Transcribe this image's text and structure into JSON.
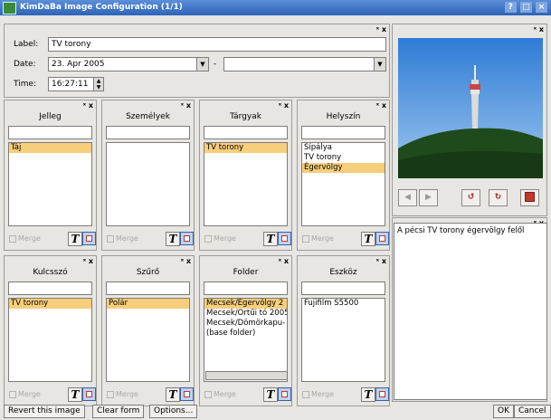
{
  "window": {
    "title": "KimDaBa Image Configuration (1/1)",
    "buttons": [
      "?",
      "□",
      "×"
    ]
  },
  "dock_close": "ˣ x",
  "fields": {
    "label_caption": "Label:",
    "label_value": "TV torony",
    "date_caption": "Date:",
    "date_from": "23. Apr 2005",
    "date_separator": "-",
    "date_to": "",
    "time_caption": "Time:",
    "time_value": "16:27:11"
  },
  "categories": [
    {
      "title": "Jelleg",
      "items": [
        "Táj"
      ],
      "selected": [
        "Táj"
      ]
    },
    {
      "title": "Személyek",
      "items": [],
      "selected": []
    },
    {
      "title": "Tárgyak",
      "items": [
        "TV torony"
      ],
      "selected": [
        "TV torony"
      ]
    },
    {
      "title": "Helyszín",
      "items": [
        "Sípálya",
        "TV torony",
        "Égervölgy"
      ],
      "selected": [
        "Égervölgy"
      ]
    },
    {
      "title": "Kulcsszó",
      "items": [
        "TV torony"
      ],
      "selected": [
        "TV torony"
      ]
    },
    {
      "title": "Szűrő",
      "items": [
        "Polár"
      ],
      "selected": [
        "Polár"
      ]
    },
    {
      "title": "Folder",
      "items": [
        "Mecsek/Égervölgy 2",
        "Mecsek/Ortűi tó 2005",
        "Mecsek/Dömörkapu-",
        "(base folder)"
      ],
      "selected": [
        "Mecsek/Égervölgy 2"
      ]
    },
    {
      "title": "Eszköz",
      "items": [
        "Fujifilm S5500"
      ],
      "selected": []
    }
  ],
  "merge_label": "Merge",
  "text_button": "T",
  "description": "A pécsi TV torony égervölgy felől",
  "buttons": {
    "revert": "Revert this image",
    "clear": "Clear form",
    "options": "Options...",
    "ok": "OK",
    "cancel": "Cancel"
  },
  "icons": {
    "prev": "prev-arrow-icon",
    "next": "next-arrow-icon",
    "rotate_left": "rotate-left-icon",
    "rotate_right": "rotate-right-icon",
    "delete": "delete-image-icon"
  }
}
